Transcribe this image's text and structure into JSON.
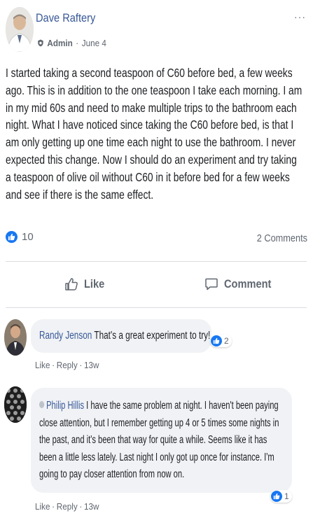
{
  "post": {
    "author": "Dave Raftery",
    "role": "Admin",
    "dot": "·",
    "date": "June 4",
    "more": "···",
    "body": "I started taking a second teaspoon of C60 before bed, a few weeks ago. This is in addition to the one teaspoon I take each morning. I am in my mid 60s and need to make multiple trips to the bathroom each night. What I have noticed since taking the C60 before bed, is that I am only getting up one time each night to use the bathroom. I never expected this change. Now I should do an experiment and try taking a teaspoon of olive oil without C60 in it before bed for a few weeks and see if there is the same effect.",
    "like_count": "10",
    "comments_count": "2 Comments"
  },
  "actions": {
    "like": "Like",
    "comment": "Comment"
  },
  "comments": [
    {
      "author": "Randy Jenson",
      "text": "That's a great experiment to try!",
      "reactions": "2",
      "like": "Like",
      "reply": "Reply",
      "time": "13w"
    },
    {
      "author": "Philip Hillis",
      "text": "I have the same problem at night. I haven't been paying close attention, but I remember getting up 4 or 5 times some nights in the past, and it's been that way for quite a while. Seems like it has been a little less lately. Last night I only got up once for instance. I'm going to pay closer attention from now on.",
      "reactions": "1",
      "like": "Like",
      "reply": "Reply",
      "time": "13w"
    }
  ],
  "colors": {
    "link": "#385898",
    "like_blue": "#1877f2",
    "muted": "#606770",
    "bubble": "#f0f2f5"
  },
  "icons": [
    "more-icon",
    "admin-badge-icon",
    "like-reaction-icon",
    "thumbs-up-icon",
    "comment-icon"
  ]
}
